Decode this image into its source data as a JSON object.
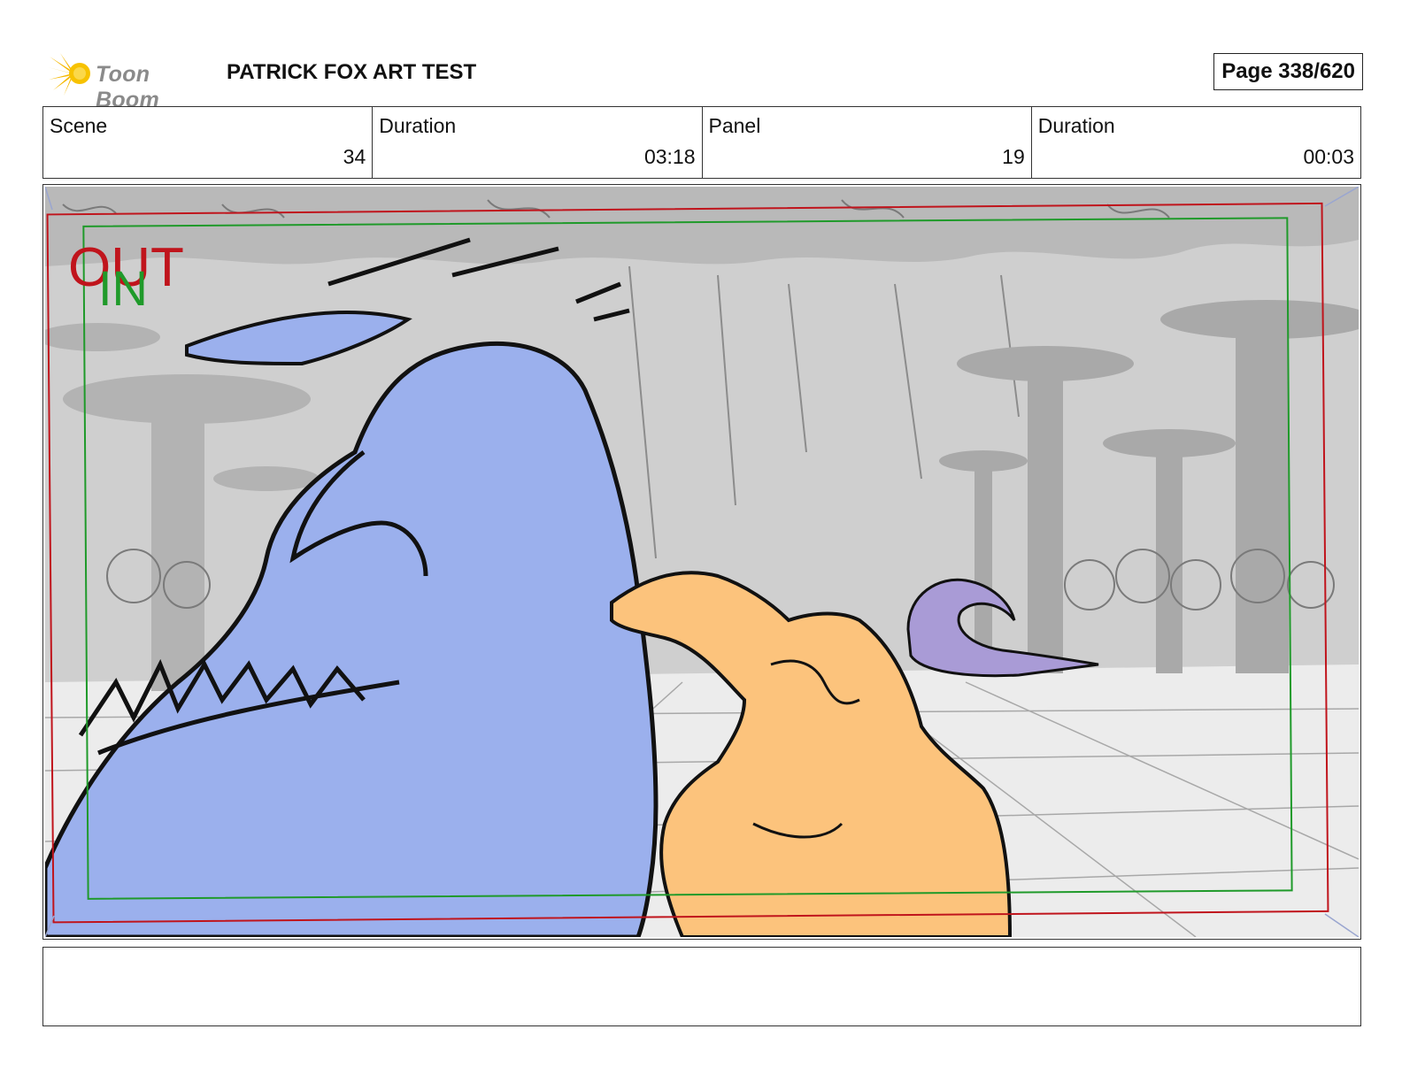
{
  "header": {
    "logo_text": "Toon Boom",
    "project_title": "PATRICK FOX ART TEST",
    "page_label": "Page 338/620"
  },
  "info": {
    "scene_label": "Scene",
    "scene_value": "34",
    "scene_duration_label": "Duration",
    "scene_duration_value": "03:18",
    "panel_label": "Panel",
    "panel_value": "19",
    "panel_duration_label": "Duration",
    "panel_duration_value": "00:03"
  },
  "panel": {
    "out_marker": "OUT",
    "in_marker": "IN",
    "out_color": "#c0141c",
    "in_color": "#1f9a2a"
  },
  "notes": {
    "text": ""
  }
}
